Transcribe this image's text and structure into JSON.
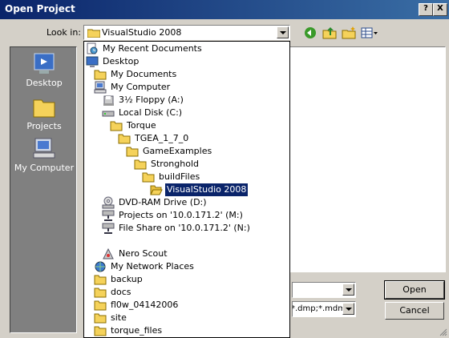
{
  "window": {
    "title": "Open Project"
  },
  "title_buttons": {
    "help": "?",
    "close": "X"
  },
  "lookin": {
    "label": "Look in:",
    "value": "VisualStudio 2008"
  },
  "toolbar": {
    "icons": [
      "back-icon",
      "up-folder-icon",
      "new-folder-icon",
      "views-menu-icon"
    ]
  },
  "places": [
    {
      "label": "Desktop",
      "icon": "desktop-icon"
    },
    {
      "label": "Projects",
      "icon": "folder-icon"
    },
    {
      "label": "My Computer",
      "icon": "computer-icon"
    }
  ],
  "dropdown": {
    "items": [
      {
        "label": "My Recent Documents",
        "icon": "recent-icon",
        "indent": 0
      },
      {
        "label": "Desktop",
        "icon": "desktop-icon",
        "indent": 0
      },
      {
        "label": "My Documents",
        "icon": "folder-icon",
        "indent": 1
      },
      {
        "label": "My Computer",
        "icon": "computer-icon",
        "indent": 1
      },
      {
        "label": "3½ Floppy (A:)",
        "icon": "floppy-icon",
        "indent": 2
      },
      {
        "label": "Local Disk (C:)",
        "icon": "disk-icon",
        "indent": 2
      },
      {
        "label": "Torque",
        "icon": "folder-icon",
        "indent": 3
      },
      {
        "label": "TGEA_1_7_0",
        "icon": "folder-icon",
        "indent": 4
      },
      {
        "label": "GameExamples",
        "icon": "folder-icon",
        "indent": 5
      },
      {
        "label": "Stronghold",
        "icon": "folder-icon",
        "indent": 6
      },
      {
        "label": "buildFiles",
        "icon": "folder-icon",
        "indent": 7
      },
      {
        "label": "VisualStudio 2008",
        "icon": "open-folder-icon",
        "indent": 8,
        "selected": true
      },
      {
        "label": "DVD-RAM Drive (D:)",
        "icon": "cd-drive-icon",
        "indent": 2
      },
      {
        "label": "Projects on '10.0.171.2' (M:)",
        "icon": "network-drive-icon",
        "indent": 2
      },
      {
        "label": "File Share on '10.0.171.2' (N:)",
        "icon": "network-drive-icon",
        "indent": 2
      },
      {
        "label": "",
        "icon": "",
        "indent": 0
      },
      {
        "label": "Nero Scout",
        "icon": "nero-icon",
        "indent": 2
      },
      {
        "label": "My Network Places",
        "icon": "network-icon",
        "indent": 1
      },
      {
        "label": "backup",
        "icon": "folder-icon",
        "indent": 1
      },
      {
        "label": "docs",
        "icon": "folder-icon",
        "indent": 1
      },
      {
        "label": "fl0w_04142006",
        "icon": "folder-icon",
        "indent": 1
      },
      {
        "label": "site",
        "icon": "folder-icon",
        "indent": 1
      },
      {
        "label": "torque_files",
        "icon": "folder-icon",
        "indent": 1
      }
    ]
  },
  "file_name": {
    "value": ""
  },
  "file_type": {
    "value": "*.dmp;*.mdmp"
  },
  "buttons": {
    "open": "Open",
    "cancel": "Cancel"
  },
  "colors": {
    "titlebar": "#0a246a",
    "selection": "#0a246a",
    "face": "#d4d0c8",
    "places_bg": "#808080",
    "folder": "#f5d25a"
  }
}
